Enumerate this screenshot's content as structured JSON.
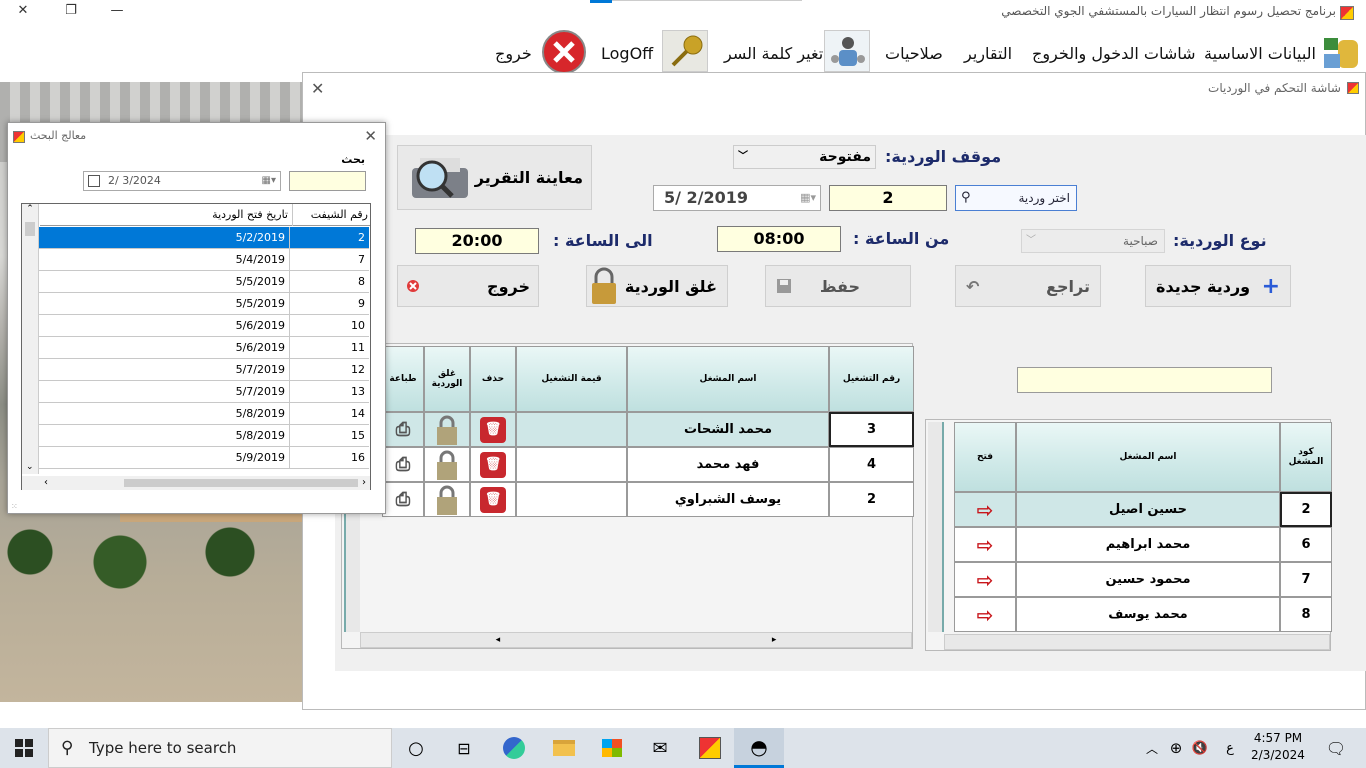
{
  "app": {
    "title": "برنامج تحصيل رسوم انتظار السيارات بالمستشفي الجوي التخصصي"
  },
  "menu": {
    "basic_data": "البيانات الاساسية",
    "entry_exit": "شاشات الدخول والخروج",
    "reports": "التقارير",
    "permissions": "صلاحيات",
    "change_password": "تغير كلمة السر",
    "logoff": "LogOff",
    "exit": "خروج"
  },
  "shift_window": {
    "title": "شاشة التحكم في الورديات",
    "status_label": "موقف الوردية:",
    "status_value": "مفتوحة",
    "preview_report": "معاينة التقرير",
    "date_value": "5/  2/2019",
    "shift_number": "2",
    "choose_shift": "اختر وردية",
    "from_time_label": "من الساعة :",
    "from_time": "08:00",
    "to_time_label": "الى الساعة :",
    "to_time": "20:00",
    "shift_type_label": "نوع الوردية:",
    "shift_type_value": "صباحية",
    "new_shift": "وردية جديدة",
    "undo": "تراجع",
    "save": "حفظ",
    "close_shift": "غلق الوردية",
    "exit": "خروج",
    "operations_grid": {
      "headers": {
        "op_number": "رقم التشغيل",
        "operator_name": "اسم المشغل",
        "op_value": "قيمة التشغيل",
        "delete": "حذف",
        "close_shift": "غلق الوردية",
        "print": "طباعة"
      },
      "rows": [
        {
          "op_number": "3",
          "operator_name": "محمد الشحات",
          "op_value": ""
        },
        {
          "op_number": "4",
          "operator_name": "فهد محمد",
          "op_value": ""
        },
        {
          "op_number": "2",
          "operator_name": "يوسف الشبراوي",
          "op_value": ""
        }
      ]
    },
    "operators_grid": {
      "headers": {
        "code": "كود المشغل",
        "name": "اسم المشغل",
        "open": "فتح"
      },
      "rows": [
        {
          "code": "2",
          "name": "حسين اصيل"
        },
        {
          "code": "6",
          "name": "محمد ابراهيم"
        },
        {
          "code": "7",
          "name": "محمود حسين"
        },
        {
          "code": "8",
          "name": "محمد يوسف"
        }
      ]
    }
  },
  "search_window": {
    "title": "معالج البحث",
    "search_label": "بحث",
    "date_value": "2/  3/2024",
    "headers": {
      "shift_number": "رقم الشيفت",
      "open_date": "تاريخ فتح الوردية"
    },
    "rows": [
      {
        "n": "2",
        "d": "5/2/2019"
      },
      {
        "n": "7",
        "d": "5/4/2019"
      },
      {
        "n": "8",
        "d": "5/5/2019"
      },
      {
        "n": "9",
        "d": "5/5/2019"
      },
      {
        "n": "10",
        "d": "5/6/2019"
      },
      {
        "n": "11",
        "d": "5/6/2019"
      },
      {
        "n": "12",
        "d": "5/7/2019"
      },
      {
        "n": "13",
        "d": "5/7/2019"
      },
      {
        "n": "14",
        "d": "5/8/2019"
      },
      {
        "n": "15",
        "d": "5/8/2019"
      },
      {
        "n": "16",
        "d": "5/9/2019"
      }
    ]
  },
  "taskbar": {
    "search_placeholder": "Type here to search",
    "time": "4:57 PM",
    "date": "2/3/2024",
    "lang": "ع"
  },
  "colors": {
    "accent": "#0078d7",
    "field_yellow": "#ffffe0",
    "label_blue": "#1d2b6b",
    "grid_header": "#cfe9e8"
  }
}
